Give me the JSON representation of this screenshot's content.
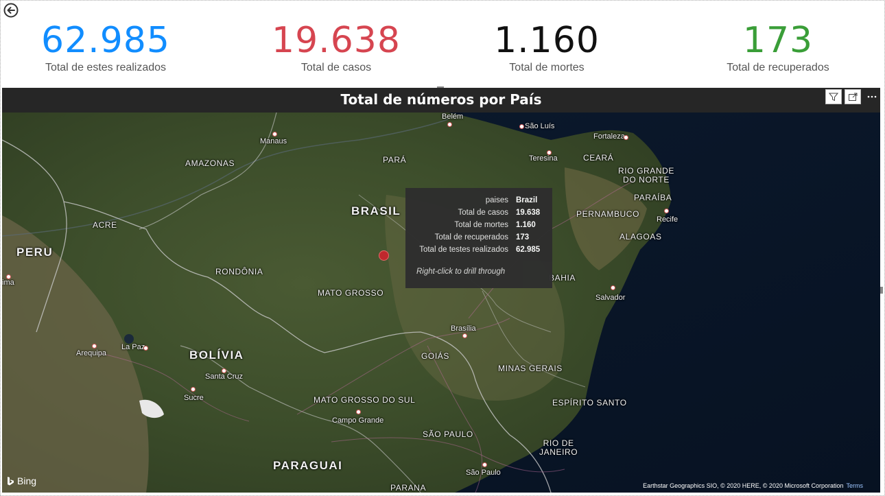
{
  "kpis": [
    {
      "value": "62.985",
      "label": "Total de estes realizados",
      "color": "#118dff"
    },
    {
      "value": "19.638",
      "label": "Total de casos",
      "color": "#d64550"
    },
    {
      "value": "1.160",
      "label": "Total de mortes",
      "color": "#111111"
    },
    {
      "value": "173",
      "label": "Total de recuperados",
      "color": "#3a9e38"
    }
  ],
  "visual": {
    "title": "Total de números por País",
    "tools": [
      "filter-icon",
      "focus-mode-icon",
      "more-options-icon"
    ]
  },
  "map": {
    "labels": {
      "belem": "Belém",
      "sao_luis": "São Luís",
      "manaus": "Manaus",
      "fortaleza": "Fortaleza",
      "amazonas": "AMAZONAS",
      "para": "PARÁ",
      "teresina": "Teresina",
      "ceara": "CEARÁ",
      "rio_grande_do_norte": "RIO GRANDE\nDO NORTE",
      "paraiba": "PARAÍBA",
      "brasil": "BRASIL",
      "pernambuco": "PERNAMBUCO",
      "recife": "Recife",
      "acre": "ACRE",
      "alagoas": "ALAGOAS",
      "peru": "PERU",
      "rondonia": "RONDÔNIA",
      "bahia": "BAHIA",
      "lima": "ima",
      "mato_grosso": "MATO GROSSO",
      "salvador": "Salvador",
      "brasilia": "Brasília",
      "arequipa": "Arequipa",
      "la_paz": "La Paz",
      "bolivia": "BOLÍVIA",
      "goias": "GOIÁS",
      "minas_gerais": "MINAS GERAIS",
      "santa_cruz": "Santa Cruz",
      "sucre": "Sucre",
      "mato_grosso_do_sul": "MATO GROSSO DO SUL",
      "espirito_santo": "ESPÍRITO SANTO",
      "campo_grande": "Campo Grande",
      "sao_paulo_state": "SÃO PAULO",
      "rio_de_janeiro": "RIO DE\nJANEIRO",
      "paraguai": "PARAGUAI",
      "sao_paulo_city": "São Paulo",
      "parana": "PARANA"
    },
    "bing_label": "Bing",
    "attribution": "Earthstar Geographics SIO, © 2020 HERE, © 2020 Microsoft Corporation",
    "terms_label": "Terms"
  },
  "tooltip": {
    "rows": [
      {
        "key": "paises",
        "value": "Brazil"
      },
      {
        "key": "Total de casos",
        "value": "19.638"
      },
      {
        "key": "Total de mortes",
        "value": "1.160"
      },
      {
        "key": "Total de recuperados",
        "value": "173"
      },
      {
        "key": "Total de testes realizados",
        "value": "62.985"
      }
    ],
    "hint": "Right-click to drill through"
  }
}
